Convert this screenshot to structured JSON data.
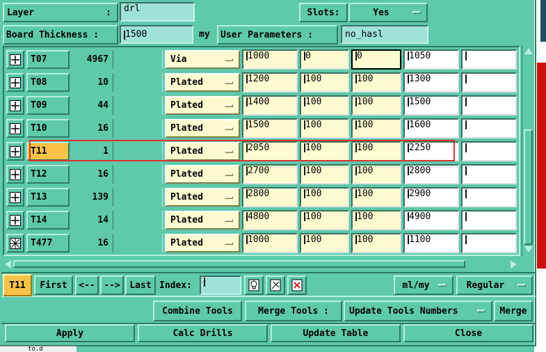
{
  "header": {
    "layer_label": "Layer",
    "layer_value": "drl",
    "slots_label": "Slots:",
    "slots_value": "Yes",
    "thickness_label": "Board Thickness :",
    "thickness_value": "1500",
    "thickness_unit": "my",
    "user_params_label": "User Parameters :",
    "user_params_value": "no_hasl"
  },
  "colon": ":",
  "tools": [
    {
      "name": "T07",
      "count": "4967",
      "type": "Via",
      "v1": "1000",
      "v2": "0",
      "v3": "0",
      "v4": "1050"
    },
    {
      "name": "T08",
      "count": "10",
      "type": "Plated",
      "v1": "1200",
      "v2": "100",
      "v3": "100",
      "v4": "1300"
    },
    {
      "name": "T09",
      "count": "44",
      "type": "Plated",
      "v1": "1400",
      "v2": "100",
      "v3": "100",
      "v4": "1500"
    },
    {
      "name": "T10",
      "count": "16",
      "type": "Plated",
      "v1": "1500",
      "v2": "100",
      "v3": "100",
      "v4": "1600"
    },
    {
      "name": "T11",
      "count": "1",
      "type": "Plated",
      "v1": "2050",
      "v2": "100",
      "v3": "100",
      "v4": "2250"
    },
    {
      "name": "T12",
      "count": "16",
      "type": "Plated",
      "v1": "2700",
      "v2": "100",
      "v3": "100",
      "v4": "2800"
    },
    {
      "name": "T13",
      "count": "139",
      "type": "Plated",
      "v1": "2800",
      "v2": "100",
      "v3": "100",
      "v4": "2900"
    },
    {
      "name": "T14",
      "count": "14",
      "type": "Plated",
      "v1": "4800",
      "v2": "100",
      "v3": "100",
      "v4": "4900"
    },
    {
      "name": "T477",
      "count": "16",
      "type": "Plated",
      "v1": "1000",
      "v2": "100",
      "v3": "100",
      "v4": "1100"
    }
  ],
  "nav": {
    "current_tool": "T11",
    "first": "First",
    "prev": "<--",
    "next": "-->",
    "last": "Last",
    "index_label": "Index:",
    "index_value": "",
    "units": "ml/my",
    "mode": "Regular"
  },
  "actions": {
    "combine": "Combine Tools",
    "merge_label": "Merge Tools :",
    "update_numbers": "Update Tools Numbers",
    "merge": "Merge",
    "apply": "Apply",
    "calc": "Calc Drills",
    "update_table": "Update Table",
    "close": "Close"
  },
  "background_label": "to.d",
  "colors": {
    "panel": "#5ec9ab",
    "field": "#fffbd0",
    "highlight": "#f7c245",
    "selection": "#e03030"
  }
}
